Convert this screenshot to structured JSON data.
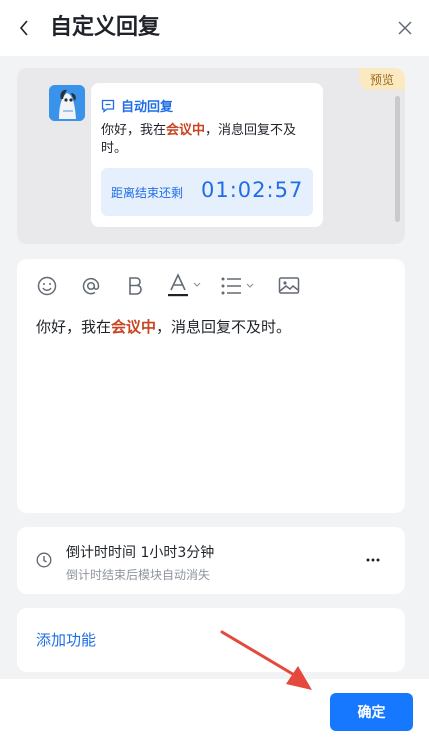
{
  "header": {
    "title": "自定义回复"
  },
  "preview": {
    "badge": "预览",
    "card": {
      "title": "自动回复",
      "text_before": "你好，我在",
      "text_highlight": "会议中",
      "text_after": "，消息回复不及时。",
      "countdown_label": "距离结束还剩",
      "countdown_value": "01:02:57"
    }
  },
  "editor": {
    "text_before": "你好，我在",
    "text_highlight": "会议中",
    "text_after": "，消息回复不及时。",
    "toolbar": [
      "emoji-icon",
      "mention-icon",
      "bold-icon",
      "font-color-icon",
      "list-icon",
      "image-icon"
    ]
  },
  "timer": {
    "title": "倒计时时间 1小时3分钟",
    "subtitle": "倒计时结束后模块自动消失",
    "more": "···"
  },
  "add_function": {
    "label": "添加功能"
  },
  "footer": {
    "confirm_label": "确定"
  },
  "colors": {
    "accent": "#1677ff",
    "highlight": "#c84320",
    "annotation_arrow": "#e5483c"
  }
}
